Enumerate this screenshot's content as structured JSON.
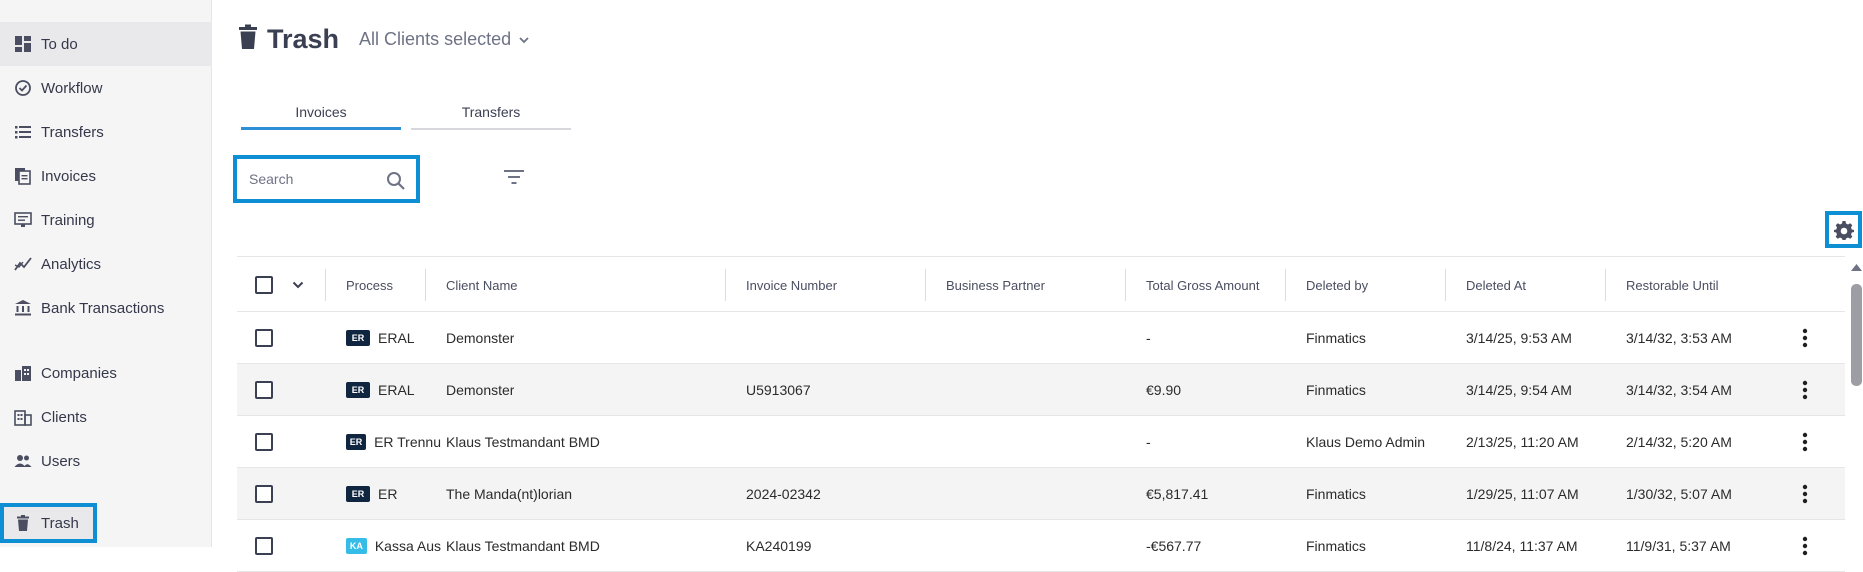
{
  "sidebar": {
    "items": [
      {
        "label": "To do",
        "icon": "dashboard-icon"
      },
      {
        "label": "Workflow",
        "icon": "check-circle-icon"
      },
      {
        "label": "Transfers",
        "icon": "list-icon"
      },
      {
        "label": "Invoices",
        "icon": "documents-icon"
      },
      {
        "label": "Training",
        "icon": "training-icon"
      },
      {
        "label": "Analytics",
        "icon": "analytics-icon"
      },
      {
        "label": "Bank Transactions",
        "icon": "bank-icon"
      },
      {
        "label": "Companies",
        "icon": "companies-icon"
      },
      {
        "label": "Clients",
        "icon": "clients-icon"
      },
      {
        "label": "Users",
        "icon": "users-icon"
      },
      {
        "label": "Trash",
        "icon": "trash-icon"
      }
    ]
  },
  "header": {
    "title": "Trash",
    "client_selector": "All Clients selected"
  },
  "tabs": [
    "Invoices",
    "Transfers"
  ],
  "search": {
    "placeholder": "Search"
  },
  "table": {
    "columns": [
      "Process",
      "Client Name",
      "Invoice Number",
      "Business Partner",
      "Total Gross Amount",
      "Deleted by",
      "Deleted At",
      "Restorable Until"
    ],
    "rows": [
      {
        "badge": "ER",
        "process": "ERAL",
        "client": "Demonster",
        "invoice": "",
        "partner": "",
        "amount": "-",
        "deleted_by": "Finmatics",
        "deleted_at": "3/14/25, 9:53 AM",
        "restorable": "3/14/32, 3:53 AM"
      },
      {
        "badge": "ER",
        "process": "ERAL",
        "client": "Demonster",
        "invoice": "U5913067",
        "partner": "",
        "amount": "€9.90",
        "deleted_by": "Finmatics",
        "deleted_at": "3/14/25, 9:54 AM",
        "restorable": "3/14/32, 3:54 AM"
      },
      {
        "badge": "ER",
        "process": "ER Trennu",
        "client": "Klaus Testmandant BMD",
        "invoice": "",
        "partner": "",
        "amount": "-",
        "deleted_by": "Klaus Demo Admin",
        "deleted_at": "2/13/25, 11:20 AM",
        "restorable": "2/14/32, 5:20 AM"
      },
      {
        "badge": "ER",
        "process": "ER",
        "client": "The Manda(nt)lorian",
        "invoice": "2024-02342",
        "partner": "",
        "amount": "€5,817.41",
        "deleted_by": "Finmatics",
        "deleted_at": "1/29/25, 11:07 AM",
        "restorable": "1/30/32, 5:07 AM"
      },
      {
        "badge": "KA",
        "process": "Kassa Aus",
        "client": "Klaus Testmandant BMD",
        "invoice": "KA240199",
        "partner": "",
        "amount": "-€567.77",
        "deleted_by": "Finmatics",
        "deleted_at": "11/8/24, 11:37 AM",
        "restorable": "11/9/31, 5:37 AM"
      }
    ]
  },
  "colors": {
    "accent": "#0e8fd4",
    "tab_active": "#2d8fd5",
    "badge_er": "#0f2540",
    "badge_ka": "#35bde8"
  }
}
